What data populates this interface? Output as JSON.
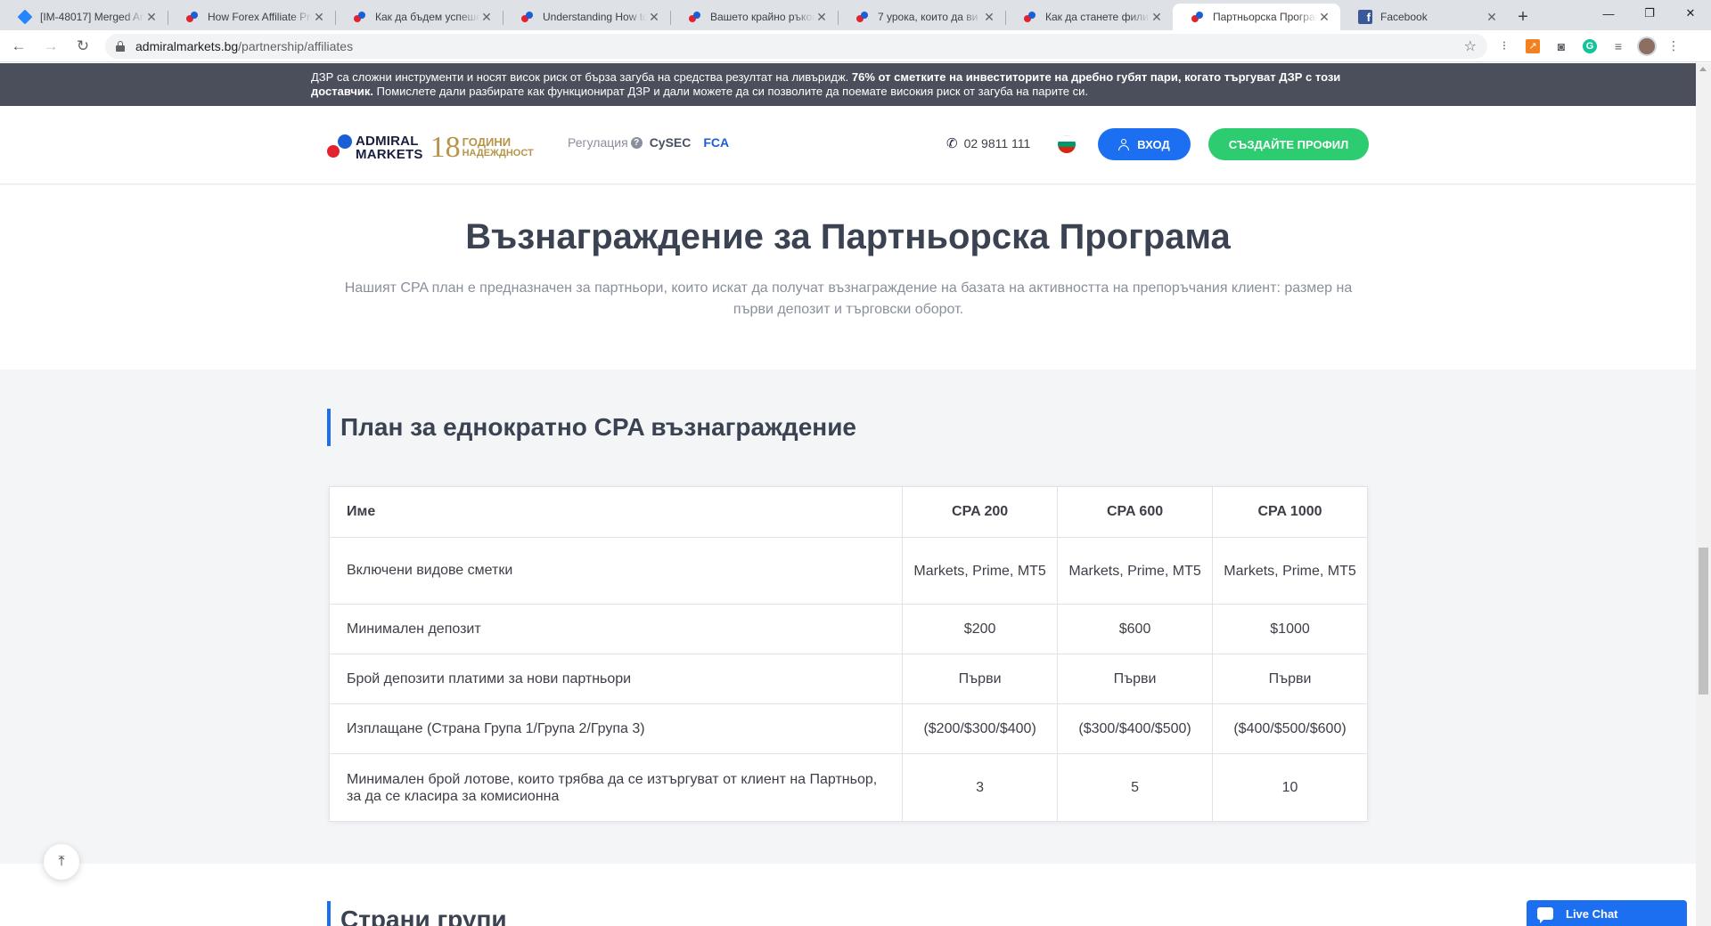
{
  "browser": {
    "tabs": [
      {
        "title": "[IM-48017] Merged Art",
        "icon": "jira-icon"
      },
      {
        "title": "How Forex Affiliate Pro",
        "icon": "admiral-icon"
      },
      {
        "title": "Как да бъдем успешен",
        "icon": "admiral-icon"
      },
      {
        "title": "Understanding How to",
        "icon": "admiral-icon"
      },
      {
        "title": "Вашето крайно ръково",
        "icon": "admiral-icon"
      },
      {
        "title": "7 урока, които да ви п",
        "icon": "admiral-icon"
      },
      {
        "title": "Как да станете филиал",
        "icon": "admiral-icon"
      },
      {
        "title": "Партньорска Програм",
        "icon": "admiral-icon",
        "active": true
      },
      {
        "title": "Facebook",
        "icon": "facebook-icon"
      }
    ],
    "url_host": "admiralmarkets.bg",
    "url_path": "/partnership/affiliates"
  },
  "risk_warning": {
    "part1": "ДЗР са сложни инструменти и носят висок риск от бърза загуба на средства резултат на ливъридж. ",
    "bold": "76% от сметките на инвеститорите на дребно губят пари, когато търгуват ДЗР с този доставчик.",
    "part2": " Помислете дали разбирате как функционират ДЗР и дали можете да си позволите да поемате високия риск от загуба на парите си."
  },
  "header": {
    "logo_line1": "ADMIRAL",
    "logo_line2": "MARKETS",
    "logo_years_number": "18",
    "logo_years_word1": "ГОДИНИ",
    "logo_years_word2": "НАДЕЖДНОСТ",
    "regulation_label": "Регулация",
    "regulator1": "CySEC",
    "regulator2": "FCA",
    "phone": "02 9811 111",
    "login_label": "ВХОД",
    "signup_label": "СЪЗДАЙТЕ ПРОФИЛ"
  },
  "hero": {
    "title": "Възнаграждение за Партньорска Програма",
    "subtitle": "Нашият CPA план е предназначен за партньори, които искат да получат възнаграждение на базата на активността на препоръчания клиент: размер на първи депозит и търговски оборот."
  },
  "plan": {
    "title": "План за еднократно CPA възнаграждение",
    "table": {
      "headers": [
        "Име",
        "CPA 200",
        "CPA 600",
        "CPA 1000"
      ],
      "rows": [
        {
          "label": "Включени видове сметки",
          "values": [
            "Markets, Prime, MT5",
            "Markets, Prime, MT5",
            "Markets, Prime, MT5"
          ]
        },
        {
          "label": "Минимален депозит",
          "values": [
            "$200",
            "$600",
            "$1000"
          ]
        },
        {
          "label": "Брой депозити платими за нови партньори",
          "values": [
            "Първи",
            "Първи",
            "Първи"
          ]
        },
        {
          "label": "Изплащане (Страна Група 1/Група 2/Група 3)",
          "values": [
            "($200/$300/$400)",
            "($300/$400/$500)",
            "($400/$500/$600)"
          ]
        },
        {
          "label": "Минимален брой лотове, които трябва да се изтъргуват от клиент на Партньор, за да се класира за комисионна",
          "values": [
            "3",
            "5",
            "10"
          ]
        }
      ]
    }
  },
  "countries": {
    "title": "Страни групи"
  },
  "live_chat_label": "Live Chat",
  "colors": {
    "brand_blue": "#1b6ff0",
    "brand_green": "#2ecc71",
    "risk_bar": "#4b4f5c"
  }
}
